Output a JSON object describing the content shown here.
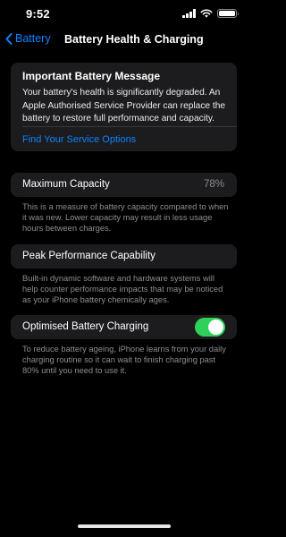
{
  "status_bar": {
    "time": "9:52",
    "icons": [
      "signal-icon",
      "wifi-icon",
      "battery-icon"
    ]
  },
  "nav": {
    "back_label": "Battery",
    "title": "Battery Health & Charging"
  },
  "message": {
    "title": "Important Battery Message",
    "body": "Your battery's health is significantly degraded. An Apple Authorised Service Provider can replace the battery to restore full performance and capacity.",
    "link": "Find Your Service Options"
  },
  "maximum_capacity": {
    "label": "Maximum Capacity",
    "value": "78%",
    "description": "This is a measure of battery capacity compared to when it was new. Lower capacity may result in less usage hours between charges."
  },
  "peak_performance": {
    "label": "Peak Performance Capability",
    "description": "Built-in dynamic software and hardware systems will help counter performance impacts that may be noticed as your iPhone battery chemically ages."
  },
  "optimised_charging": {
    "label": "Optimised Battery Charging",
    "enabled": true,
    "description": "To reduce battery ageing, iPhone learns from your daily charging routine so it can wait to finish charging past 80% until you need to use it."
  },
  "colors": {
    "accent": "#0a84ff",
    "toggle_on": "#30d158",
    "card_bg": "#1c1c1e",
    "secondary_text": "#8e8e93"
  }
}
